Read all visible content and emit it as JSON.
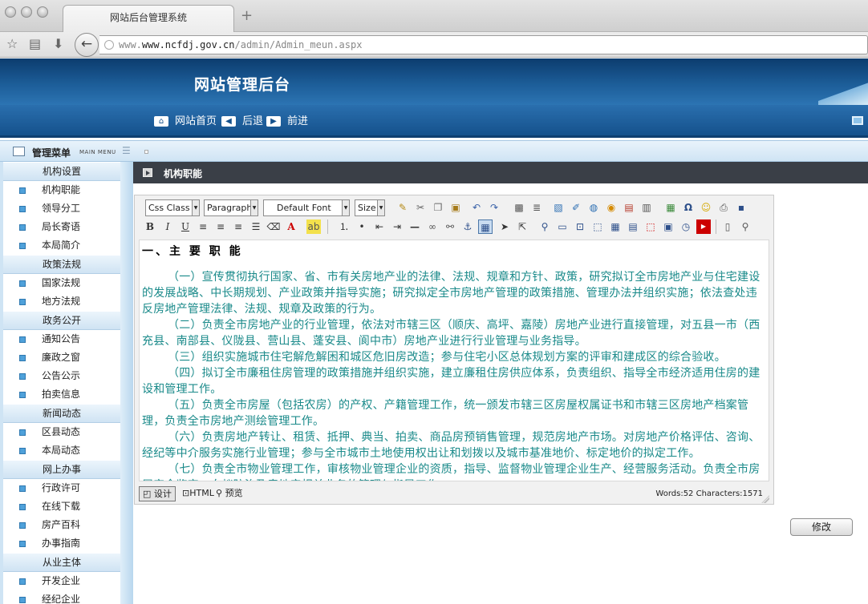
{
  "browser": {
    "tab_title": "网站后台管理系统",
    "new_tab_icon": "plus-icon",
    "url_host": "www.ncfdj.gov.cn",
    "url_path": "/admin/Admin_meun.aspx"
  },
  "header": {
    "title": "网站管理后台"
  },
  "topnav": {
    "home": "网站首页",
    "back": "后退",
    "forward": "前进"
  },
  "menu": {
    "title": "管理菜单",
    "subtitle": "MAIN MENU",
    "sections": [
      {
        "label": "机构设置",
        "items": [
          "机构职能",
          "领导分工",
          "局长寄语",
          "本局简介"
        ]
      },
      {
        "label": "政策法规",
        "items": [
          "国家法规",
          "地方法规"
        ]
      },
      {
        "label": "政务公开",
        "items": [
          "通知公告",
          "廉政之窗",
          "公告公示",
          "拍卖信息"
        ]
      },
      {
        "label": "新闻动态",
        "items": [
          "区县动态",
          "本局动态"
        ]
      },
      {
        "label": "网上办事",
        "items": [
          "行政许可",
          "在线下载",
          "房产百科",
          "办事指南"
        ]
      },
      {
        "label": "从业主体",
        "items": [
          "开发企业",
          "经纪企业"
        ]
      }
    ]
  },
  "content": {
    "title": "机构职能"
  },
  "editor": {
    "css_class": "Css Class",
    "paragraph": "Paragraph",
    "font": "Default Font",
    "size": "Size",
    "heading": "一、主 要 职 能",
    "paragraphs": [
      "（一）宣传贯彻执行国家、省、市有关房地产业的法律、法规、规章和方针、政策，研究拟订全市房地产业与住宅建设的发展战略、中长期规划、产业政策并指导实施；研究拟定全市房地产管理的政策措施、管理办法并组织实施；依法查处违反房地产管理法律、法规、规章及政策的行为。",
      "（二）负责全市房地产业的行业管理，依法对市辖三区（顺庆、高坪、嘉陵）房地产业进行直接管理，对五县一市（西充县、南部县、仪陇县、营山县、蓬安县、阆中市）房地产业进行行业管理与业务指导。",
      "（三）组织实施城市住宅解危解困和城区危旧房改造；参与住宅小区总体规划方案的评审和建成区的综合验收。",
      "（四）拟订全市廉租住房管理的政策措施并组织实施，建立廉租住房供应体系，负责组织、指导全市经济适用住房的建设和管理工作。",
      "（五）负责全市房屋（包括农房）的产权、产籍管理工作，统一颁发市辖三区房屋权属证书和市辖三区房地产档案管理，负责全市房地产测绘管理工作。",
      "（六）负责房地产转让、租赁、抵押、典当、拍卖、商品房预销售管理，规范房地产市场。对房地产价格评估、咨询、经纪等中介服务实施行业管理；参与全市城市土地使用权出让和划拨以及城市基准地价、标定地价的拟定工作。",
      "（七）负责全市物业管理工作，审核物业管理企业的资质，指导、监督物业管理企业生产、经营服务活动。负责全市房屋安全鉴定、白蚁防治及房地产相关业务的管理与指导工作。"
    ],
    "mode_design": "设计",
    "mode_html": "HTML",
    "mode_preview": "预览",
    "counts": "Words:52 Characters:1571"
  },
  "actions": {
    "save": "修改"
  }
}
